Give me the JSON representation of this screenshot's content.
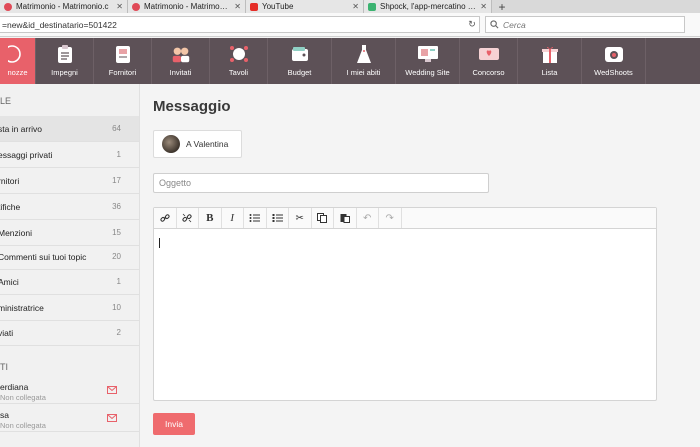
{
  "browser": {
    "tabs": [
      {
        "title": "Matrimonio - Matrimonio.c",
        "icon": "heart-favicon-icon"
      },
      {
        "title": "Matrimonio - Matrimonio.c",
        "icon": "heart-favicon-icon"
      },
      {
        "title": "YouTube",
        "icon": "youtube-favicon-icon"
      },
      {
        "title": "Shpock, l'app-mercatino de",
        "icon": "shpock-favicon-icon"
      }
    ],
    "url": "=new&id_destinatario=501422",
    "search_placeholder": "Cerca"
  },
  "menu": {
    "items": [
      {
        "label": "nozze",
        "icon": "ring-icon"
      },
      {
        "label": "Impegni",
        "icon": "checklist-icon"
      },
      {
        "label": "Fornitori",
        "icon": "vendor-icon"
      },
      {
        "label": "Invitati",
        "icon": "guests-icon"
      },
      {
        "label": "Tavoli",
        "icon": "table-icon"
      },
      {
        "label": "Budget",
        "icon": "wallet-icon"
      },
      {
        "label": "I miei abiti",
        "icon": "dress-icon"
      },
      {
        "label": "Wedding Site",
        "icon": "website-icon"
      },
      {
        "label": "Concorso",
        "icon": "ticket-icon"
      },
      {
        "label": "Lista",
        "icon": "gift-icon"
      },
      {
        "label": "WedShoots",
        "icon": "camera-icon"
      }
    ]
  },
  "sidebar": {
    "section1_title": "LE",
    "folders": [
      {
        "label": "sta in arrivo",
        "count": "64"
      },
      {
        "label": "essaggi privati",
        "count": "1"
      },
      {
        "label": "rnitori",
        "count": "17"
      },
      {
        "label": "tifiche",
        "count": "36"
      },
      {
        "label": "Menzioni",
        "count": "15"
      },
      {
        "label": "Commenti sui tuoi topic",
        "count": "20"
      },
      {
        "label": "Amici",
        "count": "1"
      },
      {
        "label": "ministratrice",
        "count": "10"
      },
      {
        "label": "viati",
        "count": "2"
      }
    ],
    "section2_title": "TI",
    "contacts": [
      {
        "name": "erdiana",
        "status": "Non collegata"
      },
      {
        "name": "sa",
        "status": "Non collegata"
      }
    ]
  },
  "main": {
    "title": "Messaggio",
    "recipient": "A Valentina",
    "subject_placeholder": "Oggetto",
    "send_label": "Invia"
  },
  "colors": {
    "menu_bg": "#5d5157",
    "accent": "#ef6b6e"
  }
}
